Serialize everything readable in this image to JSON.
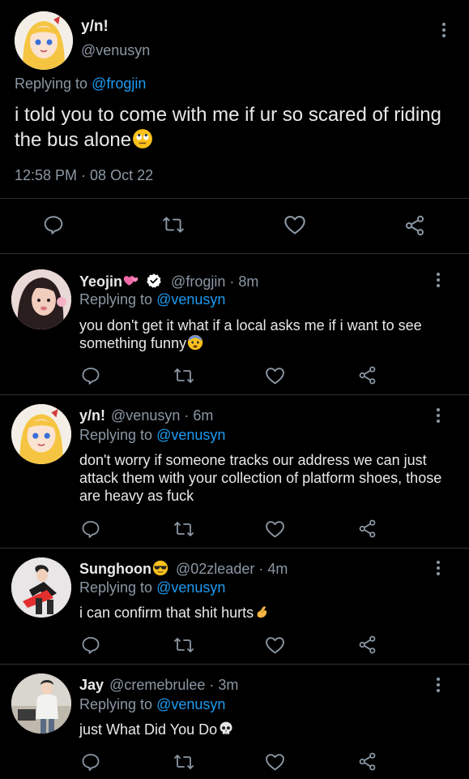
{
  "main_tweet": {
    "name": "y/n!",
    "handle": "@venusyn",
    "replying_prefix": "Replying to ",
    "replying_to": "@frogjin",
    "text": "i told you to come with me if ur so scared of riding the bus alone",
    "text_emoji": "rolling-eyes-emoji",
    "timestamp": "12:58 PM · 08 Oct 22"
  },
  "replies": [
    {
      "name": "Yeojin",
      "name_emoji": "two-hearts-emoji",
      "verified": true,
      "handle": "@frogjin",
      "time": "· 8m",
      "replying_prefix": "Replying to ",
      "replying_to": "@venusyn",
      "text": "you don't get it what if a local asks me if i want to see something funny",
      "text_emoji": "fearful-face-emoji"
    },
    {
      "name": "y/n!",
      "handle": "@venusyn",
      "time": "· 6m",
      "replying_prefix": "Replying to ",
      "replying_to": "@venusyn",
      "text": "don't worry if someone tracks our address we can just attack them with your collection of platform shoes, those are heavy as fuck"
    },
    {
      "name": "Sunghoon",
      "name_emoji": "sunglasses-face-emoji",
      "handle": "@02zleader",
      "time": "· 4m",
      "replying_prefix": "Replying to ",
      "replying_to": "@venusyn",
      "text": "i can confirm that shit hurts",
      "text_emoji": "pinching-hand-emoji"
    },
    {
      "name": "Jay",
      "handle": "@cremebrulee",
      "time": "· 3m",
      "replying_prefix": "Replying to ",
      "replying_to": "@venusyn",
      "text": "just What Did You Do",
      "text_emoji": "skull-emoji"
    }
  ],
  "icons": [
    "reply-icon",
    "retweet-icon",
    "like-icon",
    "share-icon",
    "more-options-icon",
    "verified-badge-icon"
  ],
  "colors": {
    "background": "#000000",
    "text": "#e7e9ea",
    "muted": "#8b98a5",
    "link": "#1d9bf0",
    "divider": "#2f3336",
    "verified": "#ffffff"
  }
}
